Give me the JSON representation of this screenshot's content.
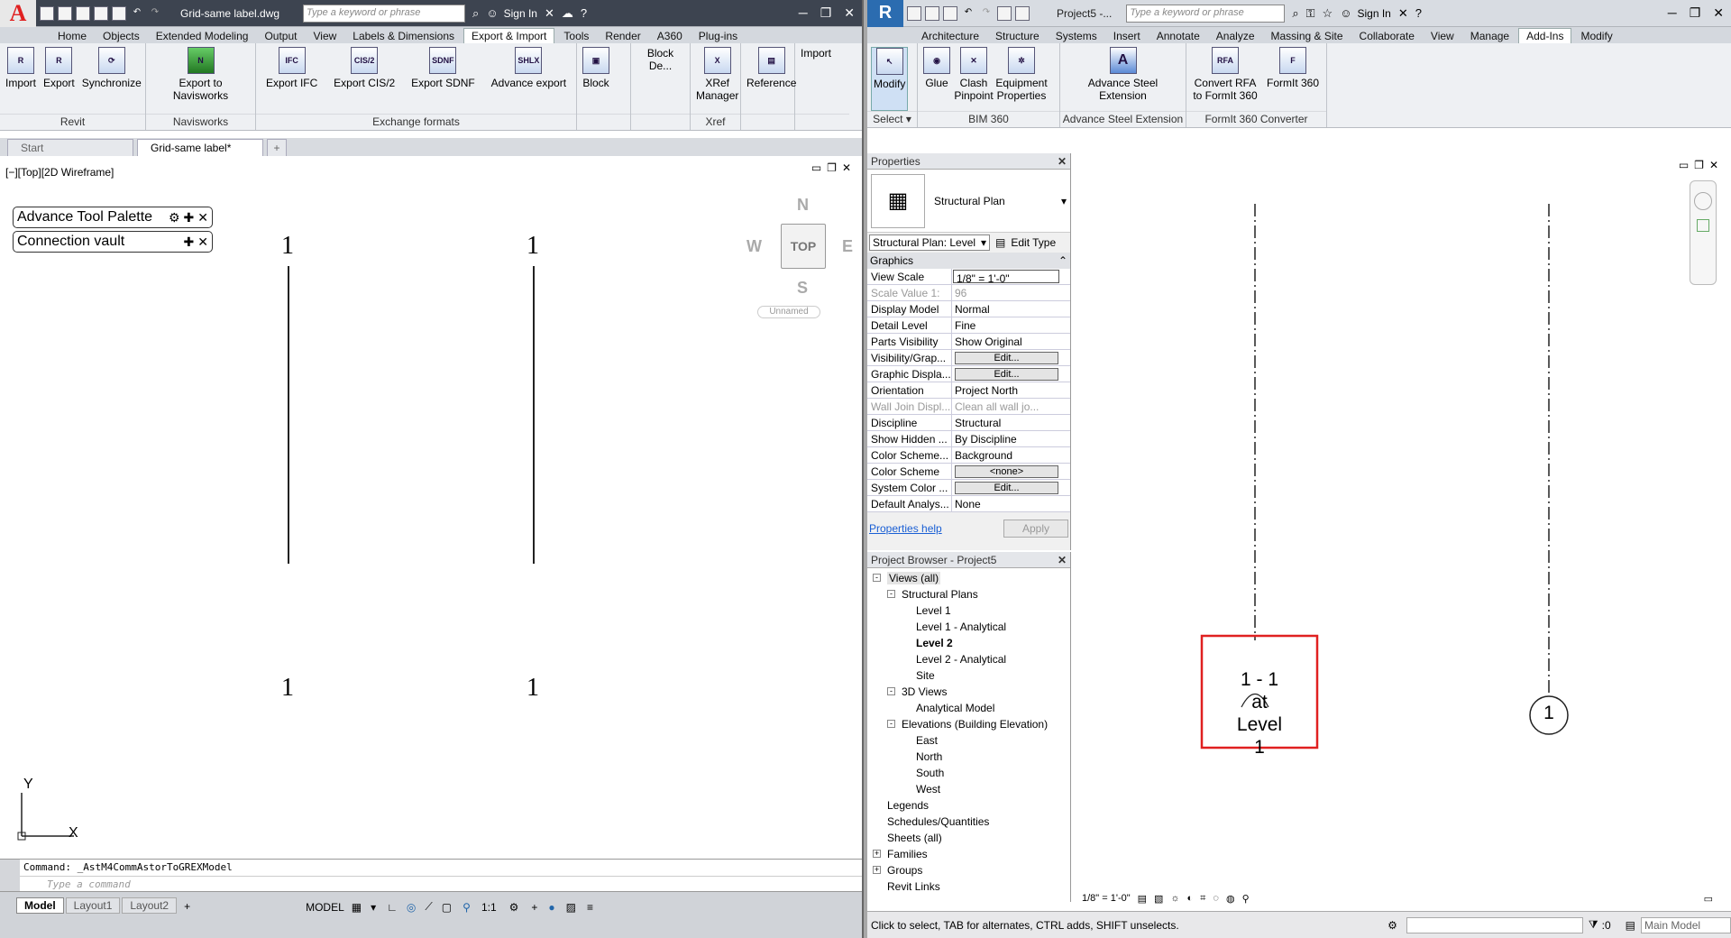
{
  "acad": {
    "title": "Grid-same label.dwg",
    "search_placeholder": "Type a keyword or phrase",
    "sign_in": "Sign In",
    "tabs": [
      "Home",
      "Objects",
      "Extended Modeling",
      "Output",
      "View",
      "Labels & Dimensions",
      "Export & Import",
      "Tools",
      "Render",
      "A360",
      "Plug-ins"
    ],
    "active_tab": "Export & Import",
    "panels": {
      "revit": {
        "title": "Revit",
        "buttons": [
          "Import",
          "Export",
          "Synchronize"
        ]
      },
      "navisworks": {
        "title": "Navisworks",
        "buttons": [
          "Export to Navisworks"
        ]
      },
      "exchange": {
        "title": "Exchange formats",
        "buttons": [
          "Export IFC",
          "Export CIS/2",
          "Export SDNF",
          "Advance export"
        ],
        "icons": [
          "IFC",
          "CIS/2",
          "SDNF",
          "SHLX"
        ]
      },
      "block": {
        "title": "",
        "buttons": [
          "Block"
        ]
      },
      "blockdef": {
        "title": "",
        "buttons": [
          "Block De..."
        ]
      },
      "xref": {
        "title": "Xref",
        "buttons": [
          "XRef Manager"
        ]
      },
      "reference": {
        "title": "",
        "buttons": [
          "Reference"
        ]
      },
      "import": {
        "title": "",
        "buttons": [
          "Import"
        ]
      }
    },
    "file_tabs": [
      "Start",
      "Grid-same label*"
    ],
    "viewport_label": "[−][Top][2D Wireframe]",
    "palettes": [
      "Advance Tool Palette",
      "Connection vault"
    ],
    "grid_labels": [
      "1",
      "1",
      "1",
      "1"
    ],
    "compass": {
      "n": "N",
      "s": "S",
      "e": "E",
      "w": "W",
      "top": "TOP",
      "ucs": "Unnamed"
    },
    "ucs_axes": {
      "x": "X",
      "y": "Y"
    },
    "command": "Command: _AstM4CommAstorToGREXModel",
    "command_placeholder": "Type a command",
    "layout_tabs": [
      "Model",
      "Layout1",
      "Layout2"
    ],
    "status": {
      "model": "MODEL",
      "scale": "1:1"
    }
  },
  "revit": {
    "title": "Project5 -...",
    "search_placeholder": "Type a keyword or phrase",
    "sign_in": "Sign In",
    "tabs": [
      "Architecture",
      "Structure",
      "Systems",
      "Insert",
      "Annotate",
      "Analyze",
      "Massing & Site",
      "Collaborate",
      "View",
      "Manage",
      "Add-Ins",
      "Modify"
    ],
    "active_tab": "Add-Ins",
    "panels": {
      "select": {
        "title": "Select ▾",
        "buttons": [
          "Modify"
        ]
      },
      "bim360": {
        "title": "BIM 360",
        "buttons": [
          "Glue",
          "Clash Pinpoint",
          "Equipment Properties"
        ]
      },
      "ase": {
        "title": "Advance Steel Extension",
        "buttons": [
          "Advance Steel Extension"
        ]
      },
      "formit": {
        "title": "FormIt 360 Converter",
        "buttons": [
          "Convert RFA to FormIt 360",
          "FormIt 360"
        ]
      }
    },
    "properties": {
      "header": "Properties",
      "type_name": "Structural Plan",
      "selector": "Structural Plan: Level",
      "edit_type": "Edit Type",
      "group": "Graphics",
      "rows": [
        {
          "k": "View Scale",
          "v": "1/8\" = 1'-0\"",
          "kind": "input"
        },
        {
          "k": "Scale Value    1:",
          "v": "96",
          "kind": "dis"
        },
        {
          "k": "Display Model",
          "v": "Normal",
          "kind": "text"
        },
        {
          "k": "Detail Level",
          "v": "Fine",
          "kind": "text"
        },
        {
          "k": "Parts Visibility",
          "v": "Show Original",
          "kind": "text"
        },
        {
          "k": "Visibility/Grap...",
          "v": "Edit...",
          "kind": "btn"
        },
        {
          "k": "Graphic Displa...",
          "v": "Edit...",
          "kind": "btn"
        },
        {
          "k": "Orientation",
          "v": "Project North",
          "kind": "text"
        },
        {
          "k": "Wall Join Displ...",
          "v": "Clean all wall jo...",
          "kind": "dis"
        },
        {
          "k": "Discipline",
          "v": "Structural",
          "kind": "text"
        },
        {
          "k": "Show Hidden ...",
          "v": "By Discipline",
          "kind": "text"
        },
        {
          "k": "Color Scheme...",
          "v": "Background",
          "kind": "text"
        },
        {
          "k": "Color Scheme",
          "v": "<none>",
          "kind": "btn"
        },
        {
          "k": "System Color ...",
          "v": "Edit...",
          "kind": "btn"
        },
        {
          "k": "Default Analys...",
          "v": "None",
          "kind": "text"
        }
      ],
      "help": "Properties help",
      "apply": "Apply"
    },
    "browser": {
      "header": "Project Browser - Project5",
      "nodes": [
        {
          "t": "Views (all)",
          "d": 0,
          "e": "-"
        },
        {
          "t": "Structural Plans",
          "d": 1,
          "e": "-"
        },
        {
          "t": "Level 1",
          "d": 2,
          "e": ""
        },
        {
          "t": "Level 1 - Analytical",
          "d": 2,
          "e": ""
        },
        {
          "t": "Level 2",
          "d": 2,
          "e": "",
          "b": true
        },
        {
          "t": "Level 2 - Analytical",
          "d": 2,
          "e": ""
        },
        {
          "t": "Site",
          "d": 2,
          "e": ""
        },
        {
          "t": "3D Views",
          "d": 1,
          "e": "-"
        },
        {
          "t": "Analytical Model",
          "d": 2,
          "e": ""
        },
        {
          "t": "Elevations (Building Elevation)",
          "d": 1,
          "e": "-"
        },
        {
          "t": "East",
          "d": 2,
          "e": ""
        },
        {
          "t": "North",
          "d": 2,
          "e": ""
        },
        {
          "t": "South",
          "d": 2,
          "e": ""
        },
        {
          "t": "West",
          "d": 2,
          "e": ""
        },
        {
          "t": "Legends",
          "d": 0,
          "e": ""
        },
        {
          "t": "Schedules/Quantities",
          "d": 0,
          "e": ""
        },
        {
          "t": "Sheets (all)",
          "d": 0,
          "e": ""
        },
        {
          "t": "Families",
          "d": 0,
          "e": "+"
        },
        {
          "t": "Groups",
          "d": 0,
          "e": "+"
        },
        {
          "t": "Revit Links",
          "d": 0,
          "e": ""
        }
      ]
    },
    "grid_tag": "1 - 1\nat\nLevel\n1",
    "grid_bubble": "1",
    "view_scale": "1/8\" = 1'-0\"",
    "status": "Click to select, TAB for alternates, CTRL adds, SHIFT unselects.",
    "zero": ":0",
    "main_model": "Main Model",
    "highlight_color": "#e02020"
  }
}
